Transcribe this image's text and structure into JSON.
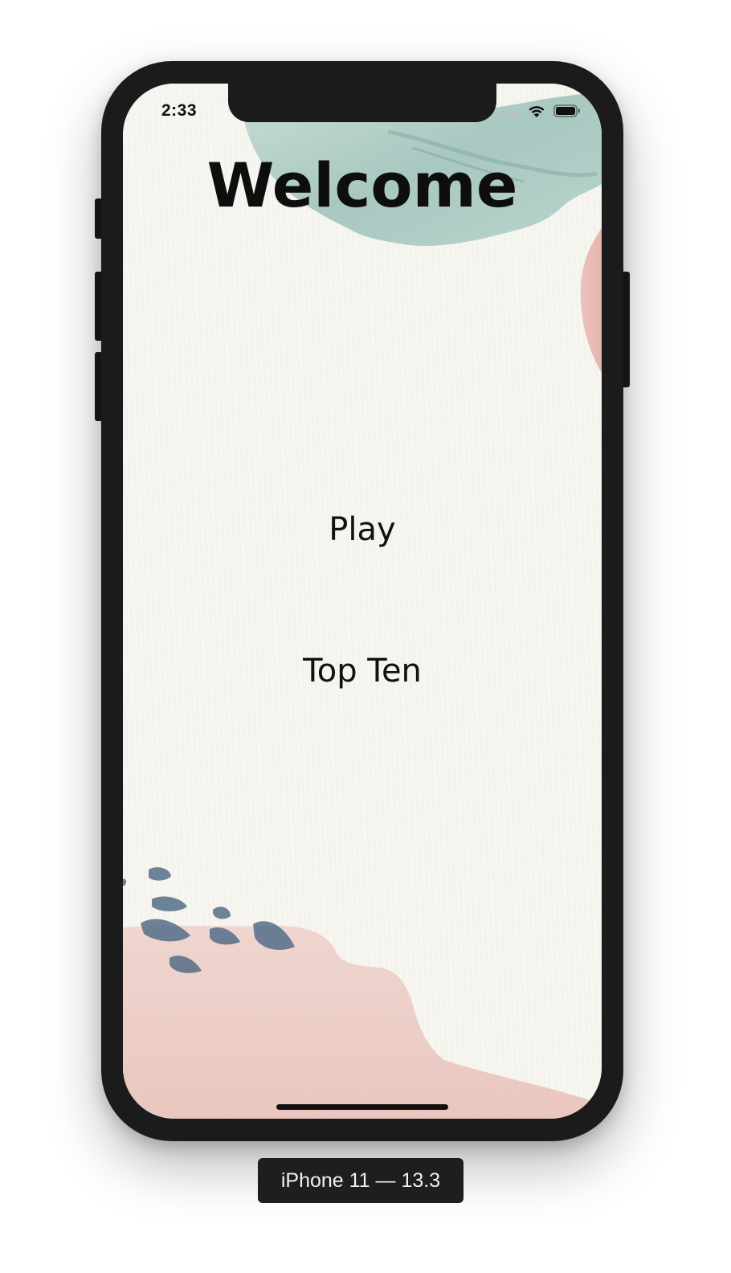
{
  "status_bar": {
    "time": "2:33",
    "wifi_icon": "wifi-icon",
    "battery_icon": "battery-icon",
    "signal_icon": "cellular-signal-icon"
  },
  "screen": {
    "title": "Welcome",
    "buttons": {
      "play": "Play",
      "top_ten": "Top Ten"
    }
  },
  "simulator": {
    "device_label": "iPhone 11 — 13.3"
  },
  "colors": {
    "background": "#f7f5f0",
    "teal_wash": "#a9c9c2",
    "pink_wash": "#ebc9c2",
    "blue_dots": "#4f6a86",
    "text": "#111111",
    "frame": "#1b1b1b"
  }
}
